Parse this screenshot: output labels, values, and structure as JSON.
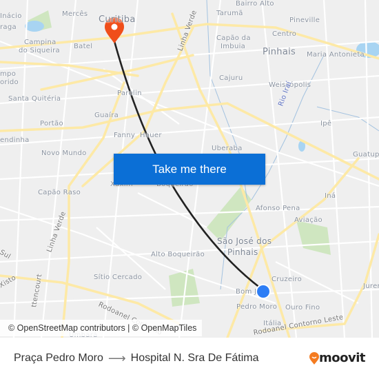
{
  "map": {
    "labels": [
      "Inácio",
      "raga",
      "Mercês",
      "Curitiba",
      "Tarumã",
      "Bairro Alto",
      "Pineville",
      "Centro",
      "Capão da",
      "Imbuia",
      "Pinhais",
      "Maria Antonieta",
      "Campina",
      "do Siqueira",
      "Batel",
      "Linha Verde",
      "mpo",
      "orido",
      "Cajuru",
      "Weissópolis",
      "Parolin",
      "Santa Quitéria",
      "Rio Iraí",
      "Ipê",
      "Guaíra",
      "Portão",
      "Fanny",
      "Hauer",
      "endinha",
      "Novo Mundo",
      "Uberaba",
      "Guatup",
      "Xaxim",
      "Boqueirão",
      "Capão Raso",
      "Iná",
      "Afonso Pena",
      "Aviação",
      "São José dos",
      "Pinhais",
      "Linha Verde",
      "Sul",
      "Alto Boqueirão",
      "Xisto",
      "Sítio Cercado",
      "Cruzeiro",
      "Jurer",
      "Bom J",
      "Pedro Moro",
      "Ouro Fino",
      "Itália",
      "Rodoanel Contorno",
      "ttencourt",
      "Rodoanel Contorno Leste",
      "Umbará",
      "Rio"
    ],
    "origin_marker": "origin-pin-icon",
    "destination_marker": "destination-dot-icon",
    "colors": {
      "background": "#efefef",
      "major_road": "#fde9a6",
      "street": "#ffffff",
      "water": "#a8d4f2",
      "park": "#cfe6c0",
      "route": "#222222",
      "origin_pin": "#f04e1a",
      "destination_dot": "#2d7df5",
      "button": "#0b6fd6"
    }
  },
  "cta": {
    "label": "Take me there"
  },
  "attribution": "© OpenStreetMap contributors | © OpenMapTiles",
  "footer": {
    "from": "Praça Pedro Moro",
    "arrow_icon": "arrow-right-icon",
    "to": "Hospital N. Sra De Fátima",
    "logo": "moovit"
  }
}
